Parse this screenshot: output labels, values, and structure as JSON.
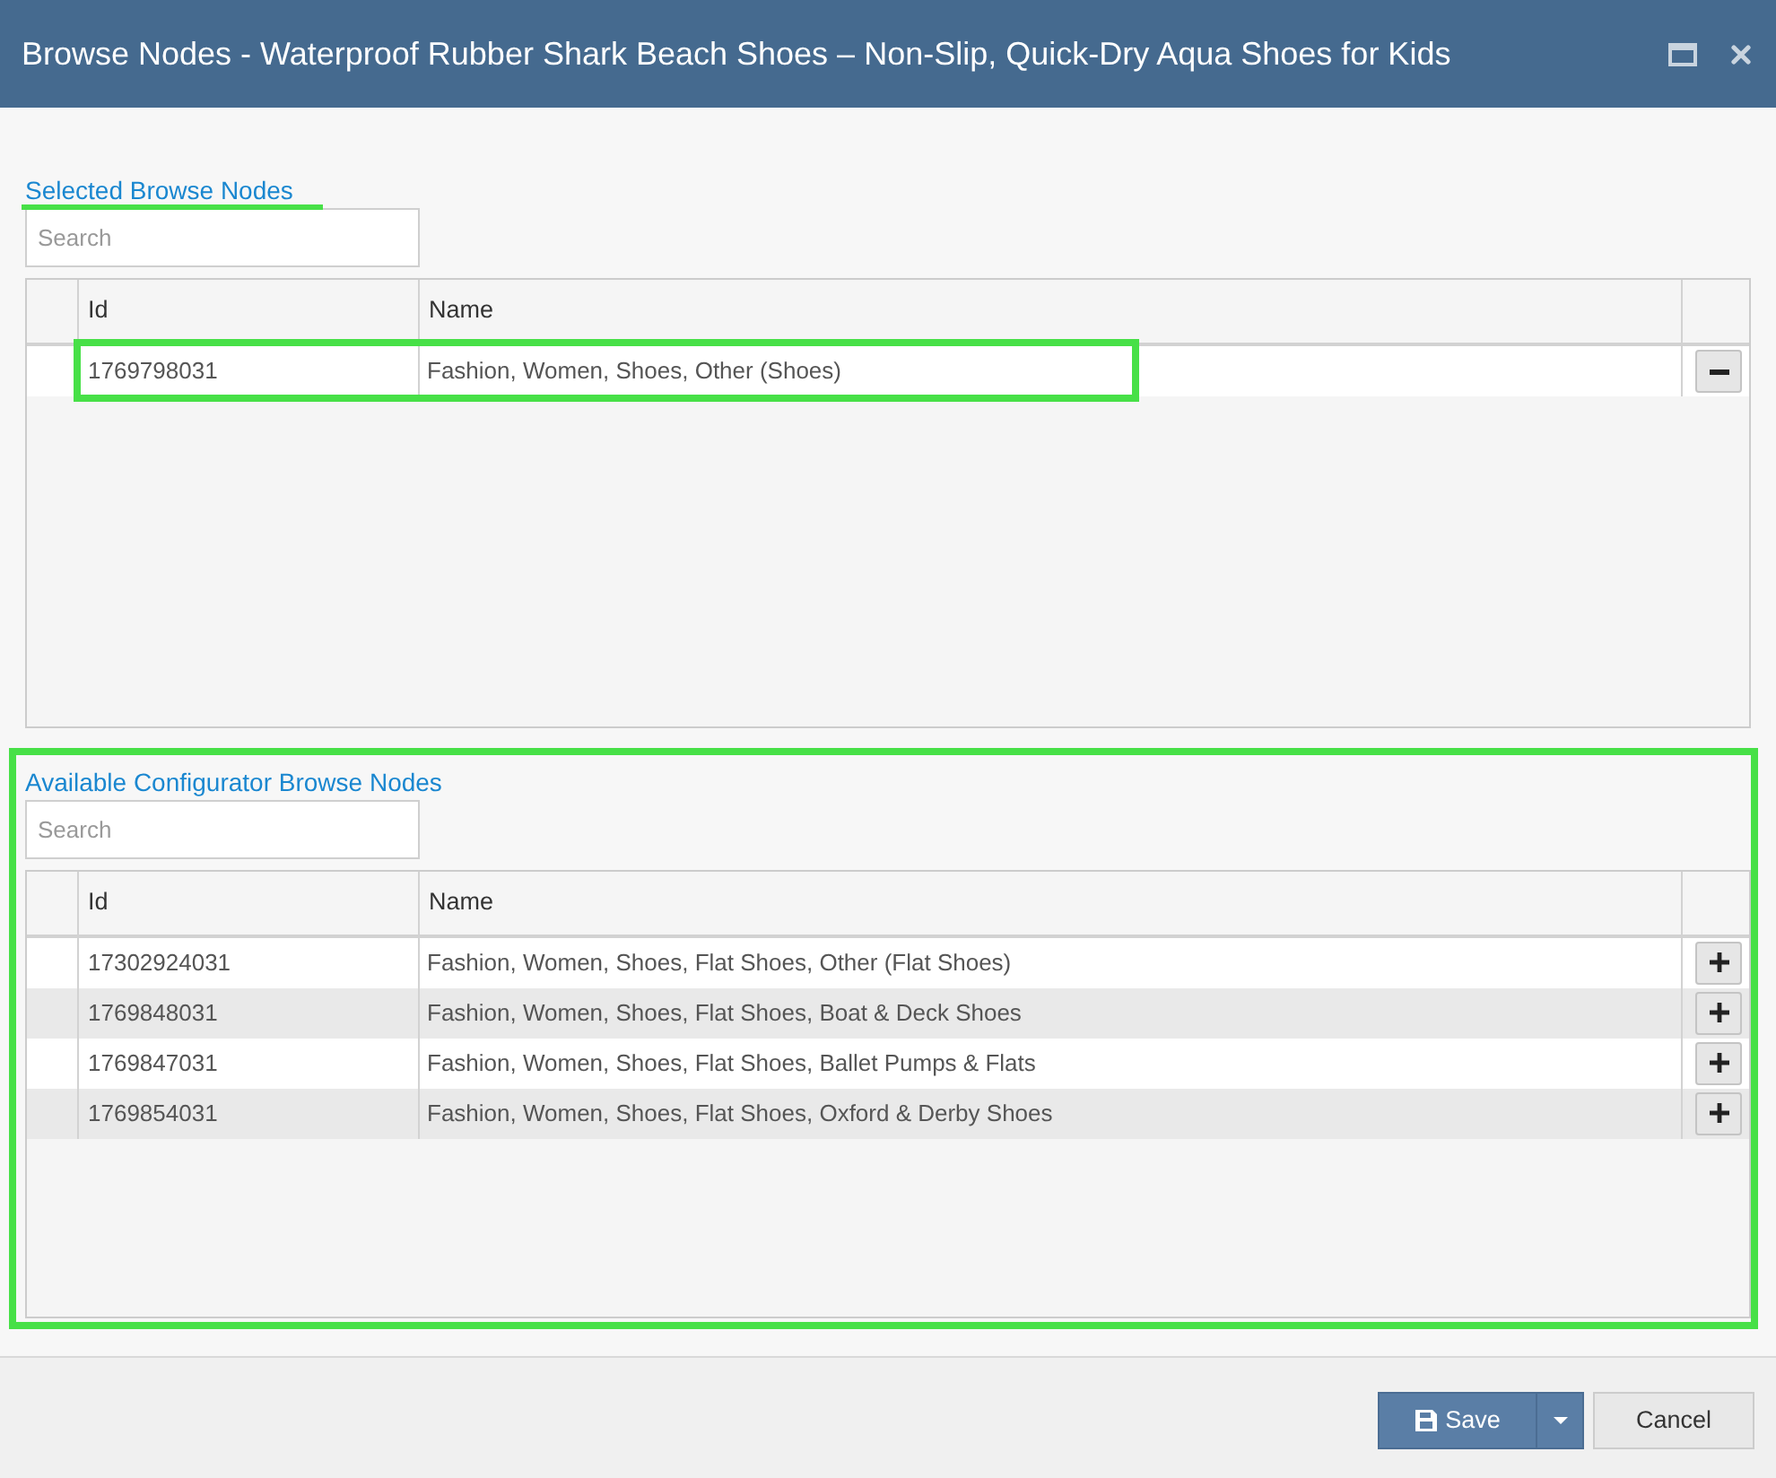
{
  "window": {
    "title": "Browse Nodes - Waterproof Rubber Shark Beach Shoes – Non-Slip, Quick-Dry Aqua Shoes for Kids"
  },
  "sections": [
    {
      "title": "Selected Browse Nodes",
      "title_highlighted": true,
      "highlighted": false,
      "search": {
        "placeholder": "Search"
      },
      "table": {
        "columns": [
          "Id",
          "Name"
        ],
        "rows": [
          {
            "id": "1769798031",
            "name": "Fashion, Women, Shoes, Other (Shoes)",
            "kind": "remove",
            "highlighted": true
          }
        ]
      }
    },
    {
      "title": "Available Configurator Browse Nodes",
      "title_highlighted": false,
      "highlighted": true,
      "search": {
        "placeholder": "Search"
      },
      "table": {
        "columns": [
          "Id",
          "Name"
        ],
        "rows": [
          {
            "id": "17302924031",
            "name": "Fashion, Women, Shoes, Flat Shoes, Other (Flat Shoes)",
            "kind": "add",
            "highlighted": false
          },
          {
            "id": "1769848031",
            "name": "Fashion, Women, Shoes, Flat Shoes, Boat & Deck Shoes",
            "kind": "add",
            "highlighted": false
          },
          {
            "id": "1769847031",
            "name": "Fashion, Women, Shoes, Flat Shoes, Ballet Pumps & Flats",
            "kind": "add",
            "highlighted": false
          },
          {
            "id": "1769854031",
            "name": "Fashion, Women, Shoes, Flat Shoes, Oxford & Derby Shoes",
            "kind": "add",
            "highlighted": false
          }
        ]
      }
    }
  ],
  "footer": {
    "buttons": [
      {
        "label": "Save",
        "kind": "split_primary"
      },
      {
        "label": "Cancel",
        "kind": "secondary"
      }
    ]
  }
}
